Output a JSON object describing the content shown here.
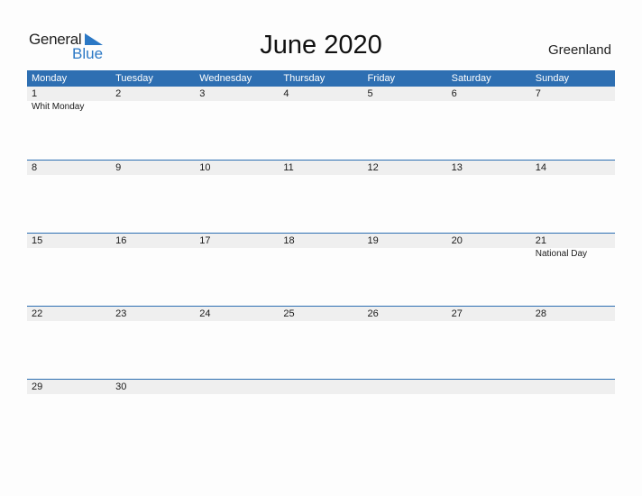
{
  "brand": {
    "line1": "General",
    "line2": "Blue",
    "accent": "#2b78c5"
  },
  "title": "June 2020",
  "country": "Greenland",
  "header_color": "#2e6fb2",
  "weekdays": [
    "Monday",
    "Tuesday",
    "Wednesday",
    "Thursday",
    "Friday",
    "Saturday",
    "Sunday"
  ],
  "weeks": [
    {
      "days": [
        "1",
        "2",
        "3",
        "4",
        "5",
        "6",
        "7"
      ],
      "events": [
        "Whit Monday",
        "",
        "",
        "",
        "",
        "",
        ""
      ]
    },
    {
      "days": [
        "8",
        "9",
        "10",
        "11",
        "12",
        "13",
        "14"
      ],
      "events": [
        "",
        "",
        "",
        "",
        "",
        "",
        ""
      ]
    },
    {
      "days": [
        "15",
        "16",
        "17",
        "18",
        "19",
        "20",
        "21"
      ],
      "events": [
        "",
        "",
        "",
        "",
        "",
        "",
        "National Day"
      ]
    },
    {
      "days": [
        "22",
        "23",
        "24",
        "25",
        "26",
        "27",
        "28"
      ],
      "events": [
        "",
        "",
        "",
        "",
        "",
        "",
        ""
      ]
    },
    {
      "days": [
        "29",
        "30",
        "",
        "",
        "",
        "",
        ""
      ],
      "events": [
        "",
        "",
        "",
        "",
        "",
        "",
        ""
      ]
    }
  ]
}
